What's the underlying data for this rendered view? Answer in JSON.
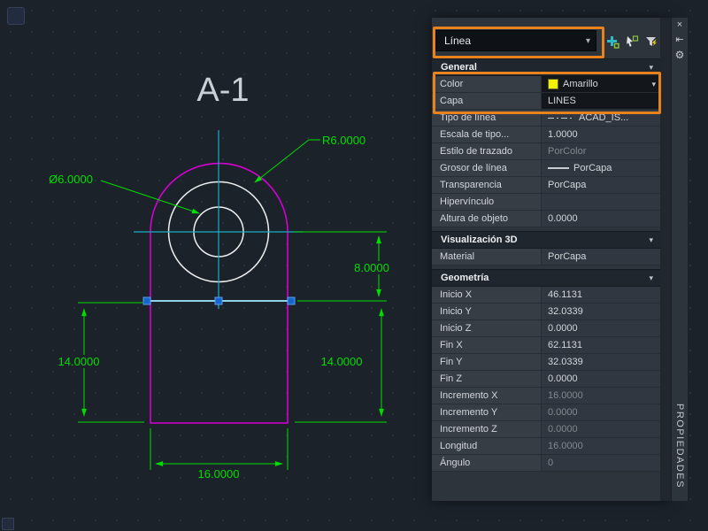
{
  "drawing": {
    "title": "A-1",
    "dims": {
      "radius": "R6.0000",
      "diameter": "Ø6.0000",
      "height_upper": "8.0000",
      "height_left": "14.0000",
      "height_right": "14.0000",
      "width_bottom": "16.0000"
    }
  },
  "panel": {
    "selector_value": "Línea",
    "chevron": "▾",
    "tab_label": "PROPIEDADES",
    "window_icons": {
      "close": "×",
      "autohide": "⇤",
      "settings": "⚙"
    },
    "sections": {
      "general": {
        "title": "General",
        "rows": [
          {
            "label": "Color",
            "value": "Amarillo"
          },
          {
            "label": "Capa",
            "value": "LINES"
          },
          {
            "label": "Tipo de línea",
            "value": "ACAD_IS..."
          },
          {
            "label": "Escala de tipo...",
            "value": "1.0000"
          },
          {
            "label": "Estilo de trazado",
            "value": "PorColor"
          },
          {
            "label": "Grosor de línea",
            "value": "PorCapa"
          },
          {
            "label": "Transparencia",
            "value": "PorCapa"
          },
          {
            "label": "Hipervínculo",
            "value": ""
          },
          {
            "label": "Altura de objeto",
            "value": "0.0000"
          }
        ]
      },
      "vis3d": {
        "title": "Visualización 3D",
        "rows": [
          {
            "label": "Material",
            "value": "PorCapa"
          }
        ]
      },
      "geometria": {
        "title": "Geometría",
        "rows": [
          {
            "label": "Inicio X",
            "value": "46.1131"
          },
          {
            "label": "Inicio Y",
            "value": "32.0339"
          },
          {
            "label": "Inicio Z",
            "value": "0.0000"
          },
          {
            "label": "Fin X",
            "value": "62.1131"
          },
          {
            "label": "Fin Y",
            "value": "32.0339"
          },
          {
            "label": "Fin Z",
            "value": "0.0000"
          },
          {
            "label": "Incremento X",
            "value": "16.0000"
          },
          {
            "label": "Incremento Y",
            "value": "0.0000"
          },
          {
            "label": "Incremento Z",
            "value": "0.0000"
          },
          {
            "label": "Longitud",
            "value": "16.0000"
          },
          {
            "label": "Ángulo",
            "value": "0"
          }
        ]
      }
    }
  },
  "colors": {
    "annotation_orange": "#e8821c",
    "swatch_yellow": "#f2f200",
    "dimension_green": "#00dd00",
    "outline_magenta": "#d400d4",
    "centerline_cyan": "#16aec2",
    "grip_blue": "#1566cc",
    "circle_white": "#eeeeee"
  }
}
